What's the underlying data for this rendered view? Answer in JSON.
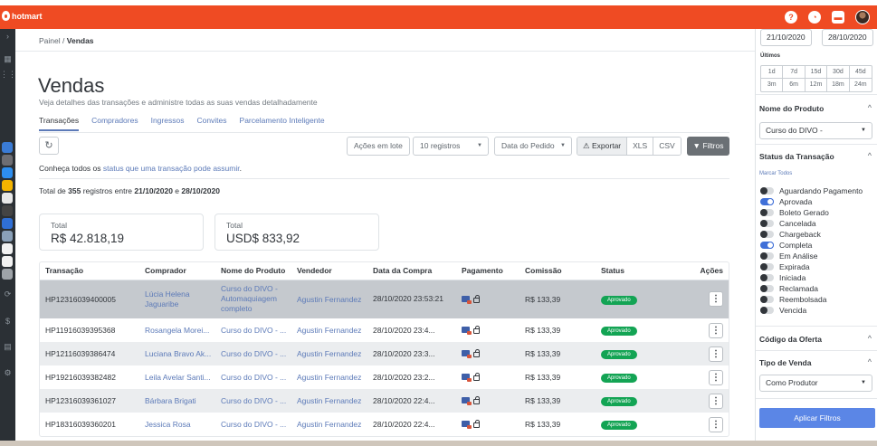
{
  "brand": {
    "name": "hotmart",
    "accent": "#ef4b23"
  },
  "top_icons": [
    "help-icon",
    "notification-icon",
    "chat-icon"
  ],
  "breadcrumb": {
    "parent": "Painel",
    "separator": "/",
    "current": "Vendas"
  },
  "page": {
    "title": "Vendas",
    "subtitle": "Veja detalhes das transações e administre todas as suas vendas detalhadamente"
  },
  "tabs": [
    "Transações",
    "Compradores",
    "Ingressos",
    "Convites",
    "Parcelamento Inteligente"
  ],
  "toolbar": {
    "refresh_icon": "↻",
    "acoes_em_lote": "Ações em lote",
    "registros": "10 registros",
    "ordenar": "Data do Pedido",
    "exportar": "Exportar",
    "xls": "XLS",
    "csv": "CSV",
    "filtros": "Filtros"
  },
  "info": {
    "prefix": "Conheça todos os ",
    "link": "status que uma transação pode assumir",
    "suffix": "."
  },
  "totals_line": {
    "p1": "Total de ",
    "count": "355",
    "p2": " registros entre ",
    "from": "21/10/2020",
    "p3": " e ",
    "to": "28/10/2020"
  },
  "cards": [
    {
      "label": "Total",
      "value": "R$ 42.818,19"
    },
    {
      "label": "Total",
      "value": "USD$ 833,92"
    }
  ],
  "table": {
    "headers": [
      "Transação",
      "Comprador",
      "Nome do Produto",
      "Vendedor",
      "Data da Compra",
      "Pagamento",
      "Comissão",
      "Status",
      "Ações"
    ],
    "rows": [
      {
        "id": "HP12316039400005",
        "buyer": "Lúcia Helena Jaguaribe",
        "product": "Curso do DIVO - Automaquiagem completo",
        "seller": "Agustin Fernandez",
        "date": "28/10/2020 23:53:21",
        "commission": "R$ 133,39",
        "status": "Aprovado"
      },
      {
        "id": "HP11916039395368",
        "buyer": "Rosangela Morei...",
        "product": "Curso do DIVO - ...",
        "seller": "Agustin Fernandez",
        "date": "28/10/2020 23:4...",
        "commission": "R$ 133,39",
        "status": "Aprovado"
      },
      {
        "id": "HP12116039386474",
        "buyer": "Luciana Bravo Ak...",
        "product": "Curso do DIVO - ...",
        "seller": "Agustin Fernandez",
        "date": "28/10/2020 23:3...",
        "commission": "R$ 133,39",
        "status": "Aprovado"
      },
      {
        "id": "HP19216039382482",
        "buyer": "Leila Avelar Santi...",
        "product": "Curso do DIVO - ...",
        "seller": "Agustin Fernandez",
        "date": "28/10/2020 23:2...",
        "commission": "R$ 133,39",
        "status": "Aprovado"
      },
      {
        "id": "HP12316039361027",
        "buyer": "Bárbara Brigati",
        "product": "Curso do DIVO - ...",
        "seller": "Agustin Fernandez",
        "date": "28/10/2020 22:4...",
        "commission": "R$ 133,39",
        "status": "Aprovado"
      },
      {
        "id": "HP18316039360201",
        "buyer": "Jessica Rosa",
        "product": "Curso do DIVO - ...",
        "seller": "Agustin Fernandez",
        "date": "28/10/2020 22:4...",
        "commission": "R$ 133,39",
        "status": "Aprovado"
      }
    ]
  },
  "filters": {
    "date_from": "21/10/2020",
    "date_to": "28/10/2020",
    "ultimos_label": "Últimos",
    "periods": [
      "1d",
      "7d",
      "15d",
      "30d",
      "45d",
      "3m",
      "6m",
      "12m",
      "18m",
      "24m"
    ],
    "produto_title": "Nome do Produto",
    "produto_value": "Curso do DIVO -",
    "status_title": "Status da Transação",
    "marcar_todos": "Marcar Todos",
    "statuses": [
      {
        "label": "Aguardando Pagamento",
        "on": false
      },
      {
        "label": "Aprovada",
        "on": true
      },
      {
        "label": "Boleto Gerado",
        "on": false
      },
      {
        "label": "Cancelada",
        "on": false
      },
      {
        "label": "Chargeback",
        "on": false
      },
      {
        "label": "Completa",
        "on": true
      },
      {
        "label": "Em Análise",
        "on": false
      },
      {
        "label": "Expirada",
        "on": false
      },
      {
        "label": "Iniciada",
        "on": false
      },
      {
        "label": "Reclamada",
        "on": false
      },
      {
        "label": "Reembolsada",
        "on": false
      },
      {
        "label": "Vencida",
        "on": false
      }
    ],
    "codigo_title": "Código da Oferta",
    "tipo_title": "Tipo de Venda",
    "tipo_value": "Como Produtor",
    "apply": "Aplicar Filtros"
  }
}
